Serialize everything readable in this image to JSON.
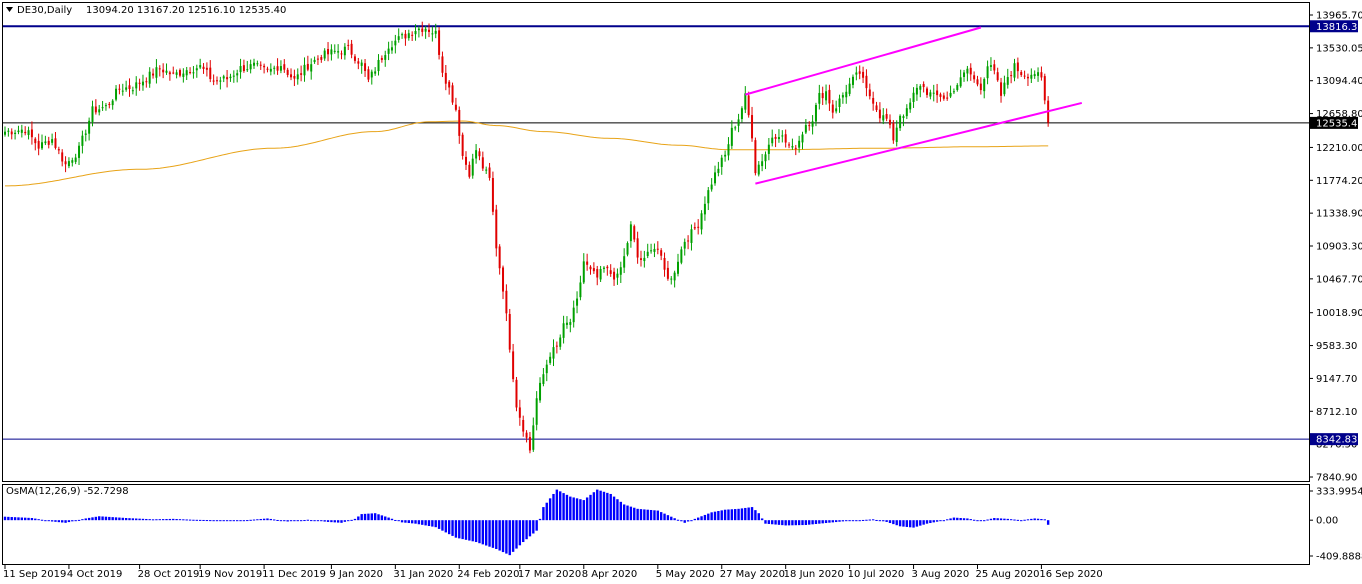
{
  "header": {
    "symbol": "DE30,Daily",
    "ohlc": "13094.20 13167.20 12516.10 12535.40",
    "osma_label": "OsMA(12,26,9) -52.7298"
  },
  "colors": {
    "bull": "#00a000",
    "bear": "#e00000",
    "ma": "#e8a317",
    "channel": "#ff00ff",
    "hline_top": "#00008b",
    "hline_bottom": "#00008b",
    "hline_current": "#000000",
    "osma": "#0000ff"
  },
  "chart_data": [
    {
      "type": "candlestick",
      "title": "DE30,Daily",
      "ylim": [
        7840.9,
        13965.7
      ],
      "y_ticks": [
        "13965.70",
        "13530.05",
        "13094.40",
        "12658.80",
        "12210.00",
        "11774.20",
        "11338.90",
        "10903.30",
        "10467.70",
        "10018.90",
        "9583.30",
        "9147.70",
        "8712.10",
        "8276.50",
        "7840.90"
      ],
      "x_ticks": [
        "11 Sep 2019",
        "4 Oct 2019",
        "28 Oct 2019",
        "19 Nov 2019",
        "11 Dec 2019",
        "9 Jan 2020",
        "31 Jan 2020",
        "24 Feb 2020",
        "17 Mar 2020",
        "8 Apr 2020",
        "5 May 2020",
        "27 May 2020",
        "18 Jun 2020",
        "10 Jul 2020",
        "3 Aug 2020",
        "25 Aug 2020",
        "16 Sep 2020"
      ],
      "price_labels": {
        "top": "13816.37",
        "current": "12535.40",
        "bottom": "8342.83"
      },
      "horizontal_lines": {
        "top": 13816.37,
        "current": 12535.4,
        "bottom": 8342.83
      },
      "anchors": [
        [
          0,
          12420
        ],
        [
          6,
          12450
        ],
        [
          10,
          12220
        ],
        [
          14,
          12320
        ],
        [
          18,
          11980
        ],
        [
          22,
          12180
        ],
        [
          26,
          12700
        ],
        [
          30,
          12750
        ],
        [
          34,
          12990
        ],
        [
          38,
          13010
        ],
        [
          42,
          13130
        ],
        [
          46,
          13260
        ],
        [
          50,
          13170
        ],
        [
          54,
          13240
        ],
        [
          58,
          13280
        ],
        [
          62,
          13090
        ],
        [
          66,
          13120
        ],
        [
          70,
          13260
        ],
        [
          74,
          13290
        ],
        [
          78,
          13210
        ],
        [
          82,
          13310
        ],
        [
          86,
          13100
        ],
        [
          90,
          13300
        ],
        [
          94,
          13420
        ],
        [
          98,
          13480
        ],
        [
          102,
          13520
        ],
        [
          106,
          13310
        ],
        [
          108,
          13090
        ],
        [
          110,
          13250
        ],
        [
          114,
          13570
        ],
        [
          118,
          13670
        ],
        [
          122,
          13780
        ],
        [
          125,
          13800
        ],
        [
          128,
          13720
        ],
        [
          130,
          13240
        ],
        [
          132,
          12990
        ],
        [
          134,
          12720
        ],
        [
          136,
          12100
        ],
        [
          138,
          11880
        ],
        [
          140,
          12180
        ],
        [
          142,
          11950
        ],
        [
          144,
          11780
        ],
        [
          146,
          10900
        ],
        [
          148,
          10350
        ],
        [
          150,
          9580
        ],
        [
          152,
          8800
        ],
        [
          154,
          8500
        ],
        [
          156,
          8200
        ],
        [
          158,
          8880
        ],
        [
          160,
          9200
        ],
        [
          162,
          9480
        ],
        [
          164,
          9550
        ],
        [
          166,
          9830
        ],
        [
          168,
          9900
        ],
        [
          170,
          10160
        ],
        [
          172,
          10700
        ],
        [
          174,
          10560
        ],
        [
          176,
          10480
        ],
        [
          178,
          10600
        ],
        [
          182,
          10480
        ],
        [
          184,
          10750
        ],
        [
          186,
          11160
        ],
        [
          188,
          10750
        ],
        [
          190,
          10700
        ],
        [
          192,
          10900
        ],
        [
          194,
          10860
        ],
        [
          196,
          10570
        ],
        [
          198,
          10450
        ],
        [
          200,
          10730
        ],
        [
          202,
          10980
        ],
        [
          204,
          11070
        ],
        [
          206,
          11200
        ],
        [
          208,
          11500
        ],
        [
          210,
          11750
        ],
        [
          212,
          11950
        ],
        [
          214,
          12100
        ],
        [
          216,
          12430
        ],
        [
          218,
          12600
        ],
        [
          220,
          12880
        ],
        [
          222,
          12380
        ],
        [
          223,
          11910
        ],
        [
          226,
          12130
        ],
        [
          228,
          12360
        ],
        [
          230,
          12400
        ],
        [
          232,
          12280
        ],
        [
          234,
          12180
        ],
        [
          236,
          12310
        ],
        [
          238,
          12520
        ],
        [
          240,
          12600
        ],
        [
          242,
          12890
        ],
        [
          244,
          12950
        ],
        [
          246,
          12690
        ],
        [
          248,
          12830
        ],
        [
          250,
          12980
        ],
        [
          252,
          13100
        ],
        [
          254,
          13200
        ],
        [
          256,
          12960
        ],
        [
          258,
          12840
        ],
        [
          260,
          12640
        ],
        [
          262,
          12580
        ],
        [
          264,
          12330
        ],
        [
          266,
          12650
        ],
        [
          268,
          12680
        ],
        [
          270,
          12900
        ],
        [
          272,
          13050
        ],
        [
          274,
          12950
        ],
        [
          276,
          12880
        ],
        [
          278,
          12900
        ],
        [
          280,
          12850
        ],
        [
          282,
          13000
        ],
        [
          284,
          13100
        ],
        [
          286,
          13250
        ],
        [
          288,
          13100
        ],
        [
          290,
          13020
        ],
        [
          292,
          13300
        ],
        [
          294,
          13200
        ],
        [
          296,
          12900
        ],
        [
          298,
          13150
        ],
        [
          300,
          13280
        ],
        [
          302,
          13200
        ],
        [
          304,
          13180
        ],
        [
          306,
          13200
        ],
        [
          308,
          13100
        ],
        [
          310,
          12540
        ]
      ],
      "moving_average": [
        [
          0,
          11700
        ],
        [
          40,
          11920
        ],
        [
          80,
          12200
        ],
        [
          110,
          12420
        ],
        [
          126,
          12550
        ],
        [
          136,
          12560
        ],
        [
          146,
          12500
        ],
        [
          160,
          12420
        ],
        [
          180,
          12330
        ],
        [
          200,
          12240
        ],
        [
          215,
          12180
        ],
        [
          230,
          12180
        ],
        [
          260,
          12200
        ],
        [
          290,
          12220
        ],
        [
          310,
          12230
        ]
      ],
      "channel_upper": [
        [
          220,
          12910
        ],
        [
          290,
          13800
        ]
      ],
      "channel_lower": [
        [
          223,
          11730
        ],
        [
          320,
          12800
        ]
      ],
      "osma": {
        "ylim": [
          -409.8888,
          333.9954
        ],
        "y_ticks": [
          "333.9954",
          "0.00",
          "-409.8888"
        ],
        "anchors": [
          [
            0,
            40
          ],
          [
            8,
            25
          ],
          [
            14,
            -15
          ],
          [
            18,
            -30
          ],
          [
            24,
            20
          ],
          [
            28,
            45
          ],
          [
            36,
            25
          ],
          [
            44,
            10
          ],
          [
            50,
            15
          ],
          [
            56,
            5
          ],
          [
            62,
            0
          ],
          [
            70,
            -5
          ],
          [
            78,
            20
          ],
          [
            84,
            -15
          ],
          [
            90,
            5
          ],
          [
            96,
            -20
          ],
          [
            100,
            -30
          ],
          [
            104,
            15
          ],
          [
            106,
            70
          ],
          [
            110,
            80
          ],
          [
            114,
            30
          ],
          [
            118,
            -25
          ],
          [
            122,
            -40
          ],
          [
            128,
            -80
          ],
          [
            134,
            -200
          ],
          [
            140,
            -250
          ],
          [
            146,
            -330
          ],
          [
            150,
            -400
          ],
          [
            154,
            -250
          ],
          [
            158,
            -120
          ],
          [
            160,
            150
          ],
          [
            164,
            350
          ],
          [
            168,
            270
          ],
          [
            172,
            230
          ],
          [
            176,
            350
          ],
          [
            180,
            300
          ],
          [
            184,
            180
          ],
          [
            188,
            130
          ],
          [
            194,
            110
          ],
          [
            198,
            40
          ],
          [
            202,
            -30
          ],
          [
            206,
            30
          ],
          [
            210,
            90
          ],
          [
            214,
            120
          ],
          [
            218,
            130
          ],
          [
            222,
            150
          ],
          [
            224,
            80
          ],
          [
            226,
            -40
          ],
          [
            232,
            -60
          ],
          [
            238,
            -55
          ],
          [
            242,
            -40
          ],
          [
            246,
            -25
          ],
          [
            250,
            -10
          ],
          [
            254,
            0
          ],
          [
            258,
            10
          ],
          [
            262,
            -20
          ],
          [
            266,
            -70
          ],
          [
            270,
            -85
          ],
          [
            274,
            -40
          ],
          [
            278,
            -10
          ],
          [
            282,
            30
          ],
          [
            286,
            20
          ],
          [
            290,
            -10
          ],
          [
            294,
            25
          ],
          [
            298,
            15
          ],
          [
            302,
            0
          ],
          [
            306,
            20
          ],
          [
            309,
            10
          ],
          [
            310,
            -52.73
          ]
        ]
      }
    }
  ]
}
